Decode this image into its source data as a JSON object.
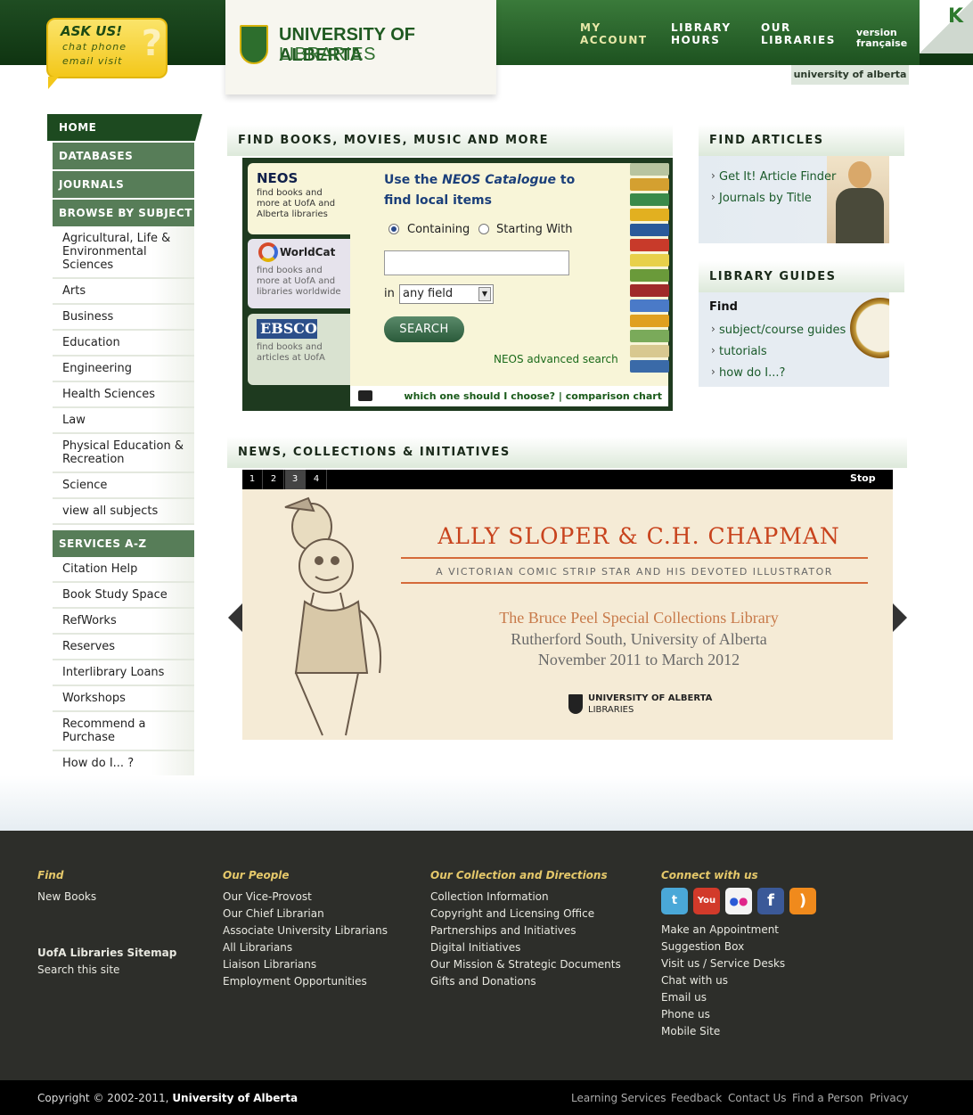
{
  "header": {
    "askus": {
      "title": "ASK US!",
      "row1": "chat   phone",
      "row2": "email   visit"
    },
    "logo": {
      "title": "UNIVERSITY OF ALBERTA",
      "subtitle": "LIBRARIES"
    },
    "nav": [
      {
        "l1": "MY",
        "l2": "ACCOUNT"
      },
      {
        "l1": "LIBRARY",
        "l2": "HOURS"
      },
      {
        "l1": "OUR",
        "l2": "LIBRARIES"
      }
    ],
    "french": {
      "l1": "version",
      "l2": "française"
    },
    "ua_tab": "university of alberta"
  },
  "sidebar": {
    "home": "HOME",
    "databases": "DATABASES",
    "journals": "JOURNALS",
    "browse": "BROWSE BY SUBJECT",
    "subjects": [
      "Agricultural, Life & Environmental Sciences",
      "Arts",
      "Business",
      "Education",
      "Engineering",
      "Health Sciences",
      "Law",
      "Physical Education & Recreation",
      "Science",
      "view all subjects"
    ],
    "services_head": "SERVICES A-Z",
    "services": [
      "Citation Help",
      "Book Study Space",
      "RefWorks",
      "Reserves",
      "Interlibrary Loans",
      "Workshops",
      "Recommend a Purchase",
      "How do I... ?"
    ]
  },
  "find": {
    "heading": "FIND BOOKS, MOVIES, MUSIC AND MORE",
    "sources": {
      "neos": {
        "title": "NEOS",
        "desc": "find books and more at UofA and Alberta libraries"
      },
      "worldcat": {
        "title": "WorldCat",
        "desc": "find books and more at UofA and libraries worldwide"
      },
      "ebsco": {
        "title": "EBSCO",
        "desc": "find books and articles at UofA"
      }
    },
    "prompt_pre": "Use the ",
    "prompt_em": "NEOS Catalogue",
    "prompt_post": " to find local items",
    "radio_containing": "Containing",
    "radio_starting": "Starting With",
    "search_value": "",
    "in_label": "in",
    "field_value": "any field",
    "search_button": "SEARCH",
    "advanced": "NEOS advanced search",
    "which": "which one should I choose? | comparison chart"
  },
  "articles": {
    "heading": "FIND ARTICLES",
    "links": [
      "Get It! Article Finder",
      "Journals by Title"
    ]
  },
  "guides": {
    "heading": "LIBRARY GUIDES",
    "find_label": "Find",
    "links": [
      "subject/course guides",
      "tutorials",
      "how do I...?"
    ]
  },
  "news": {
    "heading": "NEWS, COLLECTIONS & INITIATIVES",
    "slides": [
      "1",
      "2",
      "3",
      "4"
    ],
    "active_slide": 3,
    "stop": "Stop",
    "slide": {
      "title": "ALLY SLOPER & C.H. CHAPMAN",
      "subtitle": "A VICTORIAN COMIC STRIP STAR AND HIS DEVOTED ILLUSTRATOR",
      "library": "The Bruce Peel Special Collections Library",
      "place": "Rutherford South, University of Alberta",
      "dates": "November 2011 to March 2012",
      "logo_l1": "UNIVERSITY OF ALBERTA",
      "logo_l2": "LIBRARIES"
    }
  },
  "footer": {
    "find": {
      "head": "Find",
      "links": [
        "New Books"
      ],
      "sitemap": "UofA Libraries Sitemap",
      "search": "Search this site"
    },
    "people": {
      "head": "Our People",
      "links": [
        "Our Vice-Provost",
        "Our Chief Librarian",
        "Associate University Librarians",
        "All Librarians",
        "Liaison Librarians",
        "Employment Opportunities"
      ]
    },
    "collection": {
      "head": "Our Collection and Directions",
      "links": [
        "Collection Information",
        "Copyright and Licensing Office",
        "Partnerships and Initiatives",
        "Digital Initiatives",
        "Our Mission & Strategic Documents",
        "Gifts and Donations"
      ]
    },
    "connect": {
      "head": "Connect with us",
      "links": [
        "Make an Appointment",
        "Suggestion Box",
        "Visit us / Service Desks",
        "Chat with us",
        "Email us",
        "Phone us",
        "Mobile Site"
      ]
    },
    "social": [
      {
        "icon": "twitter-icon",
        "glyph": "t",
        "color": "#4aa8d8"
      },
      {
        "icon": "youtube-icon",
        "glyph": "You",
        "color": "#d23a2a"
      },
      {
        "icon": "flickr-icon",
        "glyph": "●●",
        "color": "#f4f4f4"
      },
      {
        "icon": "facebook-icon",
        "glyph": "f",
        "color": "#3b5998"
      },
      {
        "icon": "rss-icon",
        "glyph": ")",
        "color": "#f08a1c"
      }
    ],
    "copyright_pre": "Copyright © 2002-2011, ",
    "copyright_org": "University of Alberta",
    "bottom_links": [
      "Learning Services",
      "Feedback",
      "Contact Us",
      "Find a Person",
      "Privacy"
    ]
  }
}
